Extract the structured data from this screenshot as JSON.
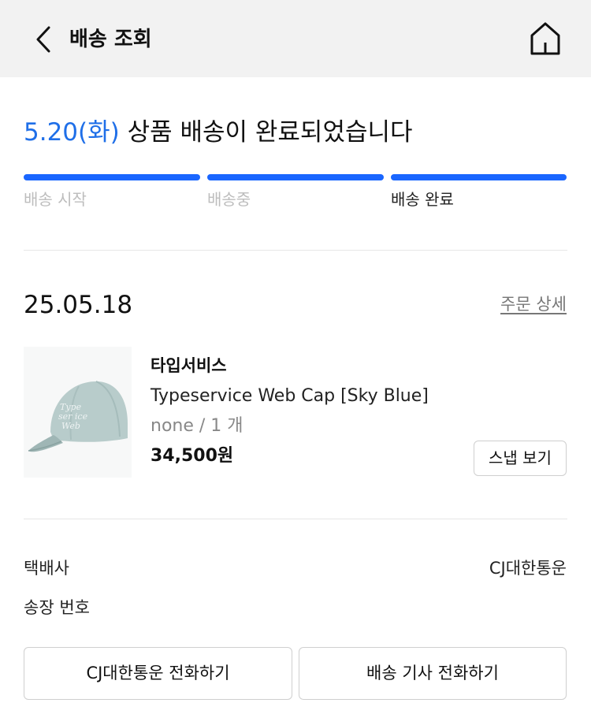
{
  "header": {
    "title": "배송 조회",
    "back_icon": "chevron-left-icon",
    "home_icon": "home-icon"
  },
  "status": {
    "date": "5.20(화)",
    "message": " 상품 배송이 완료되었습니다",
    "accent_color": "#1f6fe8",
    "progress_color": "#1a66ff",
    "steps": [
      {
        "label": "배송 시작",
        "done": true
      },
      {
        "label": "배송중",
        "done": true
      },
      {
        "label": "배송 완료",
        "done": true,
        "current": true
      }
    ]
  },
  "order": {
    "date": "25.05.18",
    "detail_link": "주문 상세",
    "item": {
      "brand": "타입서비스",
      "name": "Typeservice Web Cap [Sky Blue]",
      "option": "none / 1 개",
      "price": "34,500원",
      "snap_button": "스냅 보기"
    }
  },
  "delivery": {
    "courier_label": "택배사",
    "courier_value": "CJ대한통운",
    "tracking_label": "송장 번호",
    "tracking_value": ""
  },
  "actions": {
    "call_courier": "CJ대한통운 전화하기",
    "call_driver": "배송 기사 전화하기"
  }
}
